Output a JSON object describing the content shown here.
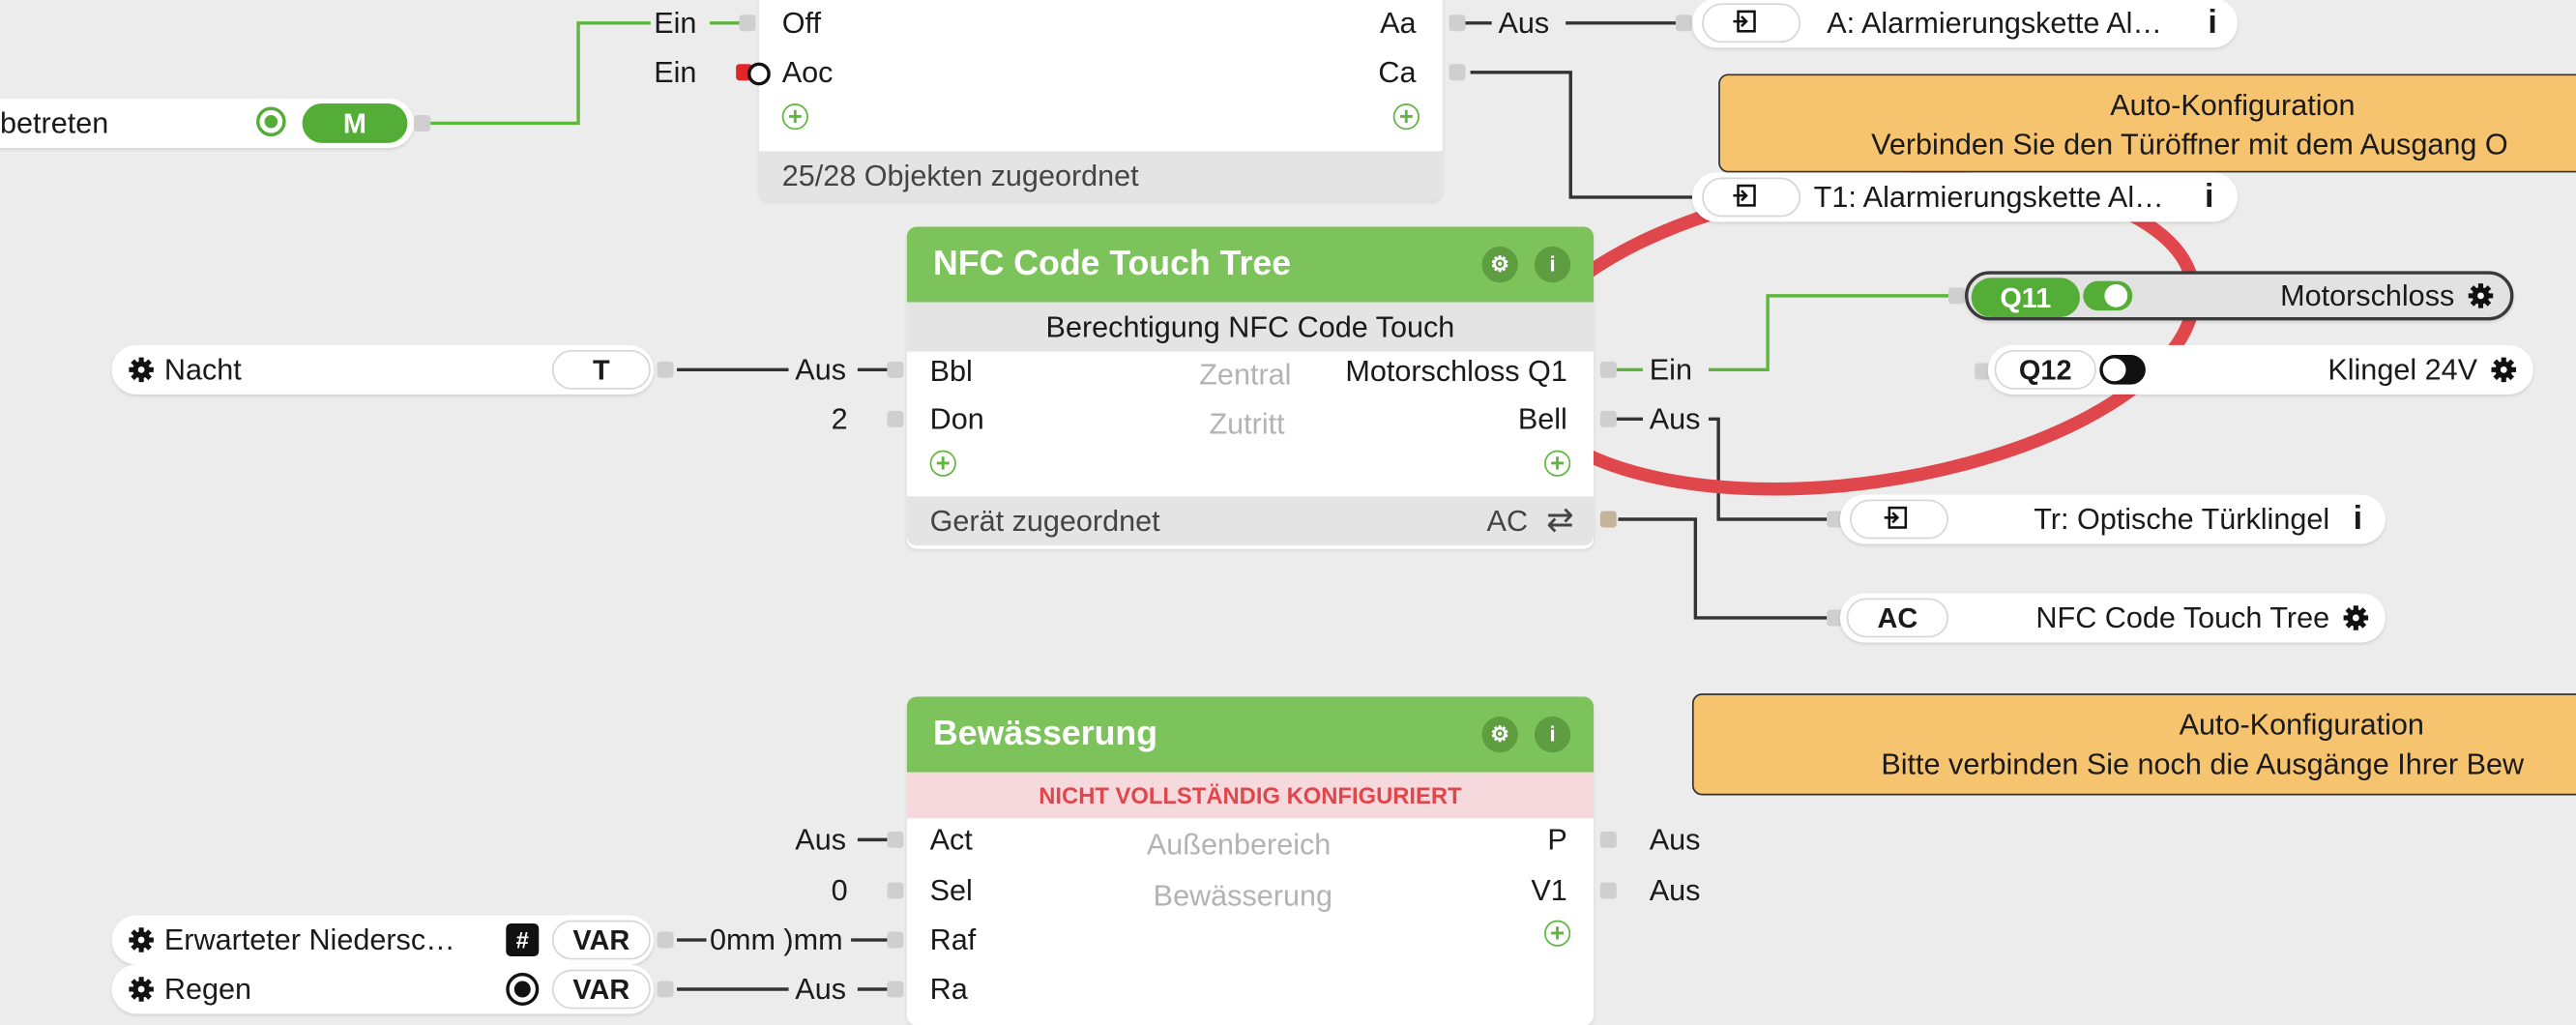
{
  "top_block": {
    "rows": [
      {
        "left_ext": "Ein",
        "in": "Off",
        "out": "Aa",
        "right_ext": "Aus"
      },
      {
        "left_ext": "Ein",
        "in": "Aoc",
        "out": "Ca"
      }
    ],
    "footer": "25/28 Objekten zugeordnet"
  },
  "left_chips": {
    "betreten": {
      "text": "betreten",
      "badge": "M"
    },
    "nacht": {
      "text": "Nacht",
      "badge": "T",
      "conn": "Aus"
    },
    "erwarteter": {
      "text": "Erwarteter  Niedersc…",
      "badge": "VAR",
      "conn": "0mm )mm"
    },
    "regen": {
      "text": "Regen",
      "badge": "VAR",
      "conn": "Aus"
    }
  },
  "nfc_block": {
    "title": "NFC Code Touch Tree",
    "subtitle": "Berechtigung NFC Code Touch",
    "inputs": [
      {
        "ext": "Aus",
        "label": "Bbl"
      },
      {
        "ext": "2",
        "label": "Don"
      }
    ],
    "center": [
      "Zentral",
      "Zutritt"
    ],
    "outputs": [
      {
        "label": "Motorschloss Q1",
        "ext": "Ein"
      },
      {
        "label": "Bell",
        "ext": "Aus"
      }
    ],
    "footer": "Gerät zugeordnet",
    "footer_right": "AC"
  },
  "irrigation_block": {
    "title": "Bewässerung",
    "warning": "NICHT VOLLSTÄNDIG KONFIGURIERT",
    "inputs": [
      {
        "ext": "Aus",
        "label": "Act"
      },
      {
        "ext": "0",
        "label": "Sel"
      },
      {
        "ext": "",
        "label": "Raf"
      },
      {
        "ext": "",
        "label": "Ra"
      }
    ],
    "center": [
      "Außenbereich",
      "Bewässerung"
    ],
    "outputs": [
      {
        "label": "P",
        "ext": "Aus"
      },
      {
        "label": "V1",
        "ext": "Aus"
      }
    ]
  },
  "right_chips": {
    "alarm_a": {
      "text": "A: Alarmierungskette Al…"
    },
    "alarm_t1": {
      "text": "T1: Alarmierungskette Al…"
    },
    "q11": {
      "badge": "Q11",
      "text": "Motorschloss"
    },
    "q12": {
      "badge": "Q12",
      "text": "Klingel 24V"
    },
    "tr": {
      "text": "Tr: Optische Türklingel"
    },
    "ac": {
      "badge": "AC",
      "text": "NFC Code Touch Tree"
    }
  },
  "notes": [
    {
      "title": "Auto-Konfiguration",
      "text": "Verbinden Sie den Türöffner mit dem Ausgang O"
    },
    {
      "title": "Auto-Konfiguration",
      "text": "Bitte verbinden Sie noch die Ausgänge Ihrer Bew"
    }
  ],
  "colors": {
    "accent_green": "#7dc35b",
    "wire_green": "#5fb63f",
    "note_bg": "#f6c36f",
    "highlight_red": "#e0474c",
    "warning_text": "#e0474c"
  }
}
